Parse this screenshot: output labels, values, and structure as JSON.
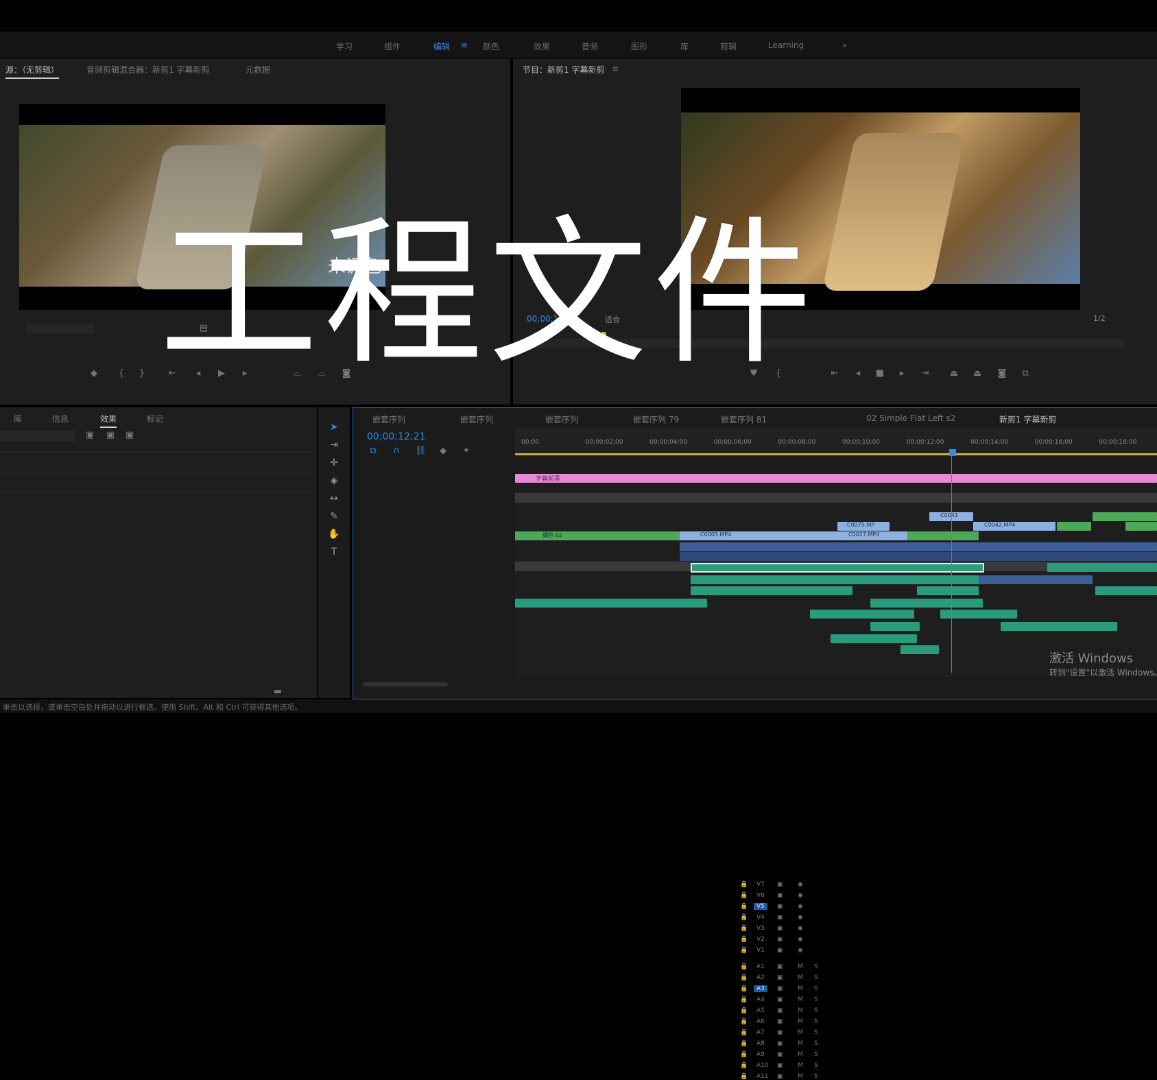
{
  "workspace_tabs": [
    "学习",
    "组件",
    "编辑",
    "颜色",
    "效果",
    "音频",
    "图形",
    "库",
    "剪辑",
    "Learning"
  ],
  "workspace_active": "编辑",
  "workspace_more": "»",
  "source_panel": {
    "tabs": [
      "源：（无剪辑）",
      "音频剪辑混合器：新剪1 字幕新剪",
      "元数据"
    ],
    "overlay_text": "未调色",
    "menu_glyph": "≡"
  },
  "program_panel": {
    "title": "节目：新剪1 字幕新剪",
    "timecode": "00;00;12;21",
    "fit_label": "适合",
    "res_label": "1/2"
  },
  "project_panel": {
    "tabs": [
      "库",
      "信息",
      "效果",
      "标记"
    ],
    "active": "效果"
  },
  "timeline": {
    "timecode": "00;00;12;21",
    "ruler": [
      "00;00",
      "00;00;02;00",
      "00;00;04;00",
      "00;00;06;00",
      "00;00;08;00",
      "00;00;10;00",
      "00;00;12;00",
      "00;00;14;00",
      "00;00;16;00",
      "00;00;18;00"
    ],
    "seq_tabs": [
      "嵌套序列",
      "嵌套序列",
      "嵌套序列",
      "嵌套序列 79",
      "嵌套序列 81",
      "02 Simple Flat Left s2",
      "新剪1 字幕新剪"
    ],
    "active_seq": "新剪1 字幕新剪",
    "video_tracks": [
      "V7",
      "V6",
      "V5",
      "V4",
      "V3",
      "V2",
      "V1"
    ],
    "audio_tracks": [
      "A1",
      "A2",
      "A3",
      "A4",
      "A5",
      "A6",
      "A7",
      "A8",
      "A9",
      "A10",
      "A11"
    ],
    "clip_labels": {
      "pink": "字幕前景",
      "v1a": "C0005.MP4",
      "v2a": "C0075.MP",
      "v1b": "C0027.MP4",
      "v3a": "C0041",
      "v2b": "C0042.MP4",
      "g1": "调色 02"
    }
  },
  "status_bar": "单击以选择，或单击空白处并拖动以进行框选。使用 Shift、Alt 和 Ctrl 可获得其他选项。",
  "overlay_title": "工程文件",
  "windows_watermark": {
    "line1": "激活 Windows",
    "line2": "转到\"设置\"以激活 Windows。"
  },
  "colors": {
    "accent": "#2d8ceb",
    "video_clip": "#8db0e0",
    "green_clip": "#4ea85a",
    "audio_clip": "#2a9c7c",
    "pink_clip": "#e889d8"
  }
}
